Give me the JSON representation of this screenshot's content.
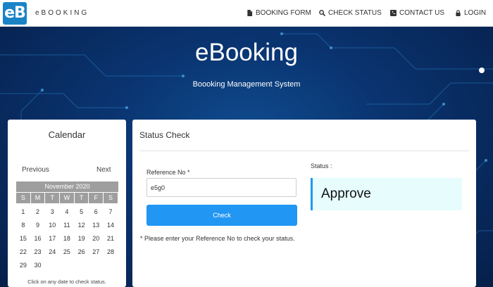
{
  "brand": {
    "logo_text": "eB",
    "name": "eBOOKING"
  },
  "nav": [
    {
      "label": "BOOKING FORM",
      "icon": "file-icon"
    },
    {
      "label": "CHECK STATUS",
      "icon": "search-icon"
    },
    {
      "label": "CONTACT US",
      "icon": "phone-icon"
    },
    {
      "label": "LOGIN",
      "icon": "lock-icon"
    }
  ],
  "hero": {
    "title": "eBooking",
    "subtitle": "Boooking Management System"
  },
  "calendar": {
    "title": "Calendar",
    "prev_label": "Previous",
    "next_label": "Next",
    "month": "November 2020",
    "weekdays": [
      "S",
      "M",
      "T",
      "W",
      "T",
      "F",
      "S"
    ],
    "weeks": [
      [
        "1",
        "2",
        "3",
        "4",
        "5",
        "6",
        "7"
      ],
      [
        "8",
        "9",
        "10",
        "11",
        "12",
        "13",
        "14"
      ],
      [
        "15",
        "16",
        "17",
        "18",
        "19",
        "20",
        "21"
      ],
      [
        "22",
        "23",
        "24",
        "25",
        "26",
        "27",
        "28"
      ],
      [
        "29",
        "30",
        "",
        "",
        "",
        "",
        ""
      ]
    ],
    "hint": "Click on any date to check status."
  },
  "status_check": {
    "title": "Status Check",
    "ref_label": "Reference No *",
    "ref_value": "e5g0",
    "check_label": "Check",
    "note": "* Please enter your Reference No to check your status.",
    "status_label": "Status :",
    "status_value": "Approve"
  },
  "colors": {
    "accent": "#2196f3",
    "logo_bg": "#1a83c6",
    "hero_bg": "#0a3470",
    "status_bg": "#e6fcfd"
  }
}
